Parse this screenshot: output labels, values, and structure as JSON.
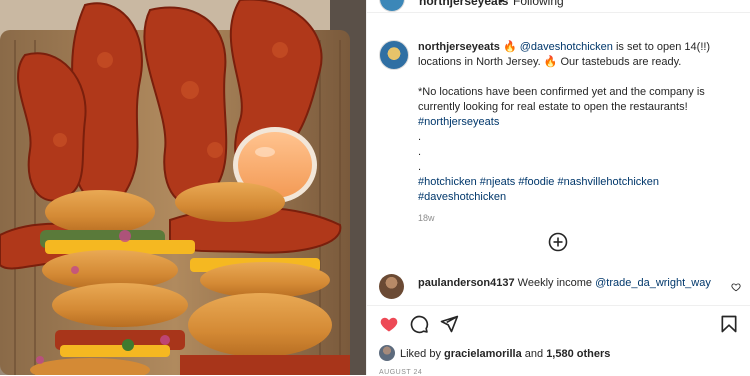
{
  "post": {
    "username": "northjerseyeats",
    "follow_separator": "•",
    "follow_status": "Following"
  },
  "caption": {
    "username": "northjerseyeats",
    "line1_pre": "🔥",
    "mention": "@daveshotchicken",
    "line1_post": "is set to open 14(!!) locations in North Jersey. 🔥 Our tastebuds are ready.",
    "paragraph2": "*No locations have been confirmed yet and the company is currently looking for real estate to open the restaurants!",
    "hashtag1": "#northjerseyeats",
    "dots": [
      ".",
      ".",
      "."
    ],
    "hashtags": [
      "#hotchicken",
      "#njeats",
      "#foodie",
      "#nashvillehotchicken",
      "#daveshotchicken"
    ],
    "time_ago": "18w"
  },
  "comment": {
    "username": "paulanderson4137",
    "text": "Weekly income",
    "mention": "@trade_da_wright_way"
  },
  "likes": {
    "prefix": "Liked by",
    "user": "gracielamorilla",
    "middle": "and",
    "count": "1,580 others"
  },
  "date": "AUGUST 24",
  "colors": {
    "like_red": "#ed4956",
    "link_blue": "#00376b",
    "muted": "#8e8e8e"
  },
  "icons": [
    "heart-icon",
    "comment-icon",
    "share-icon",
    "bookmark-icon",
    "add-circle-icon"
  ]
}
